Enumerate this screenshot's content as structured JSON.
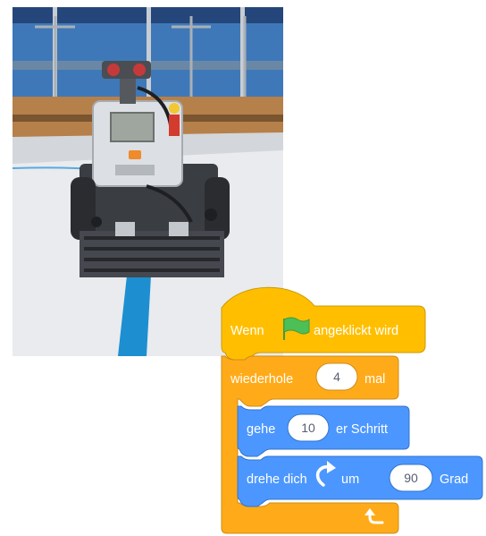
{
  "photo": {
    "icon": "robot-photo",
    "colors": {
      "window": "#2f6fb4",
      "table": "#eef0f2",
      "line": "#1d8fd1",
      "brick": "#3a3d42"
    }
  },
  "script": {
    "hat": {
      "prefix": "Wenn",
      "flag_icon": "green-flag-icon",
      "suffix": "angeklickt wird"
    },
    "repeat": {
      "label": "wiederhole",
      "count": "4",
      "unit": "mal",
      "arrow_icon": "loop-arrow-icon"
    },
    "move": {
      "label": "gehe",
      "steps": "10",
      "unit": "er Schritt"
    },
    "turn": {
      "label": "drehe dich",
      "icon": "turn-right-icon",
      "um": "um",
      "degrees": "90",
      "unit": "Grad"
    },
    "colors": {
      "events": "#ffbf00",
      "events_border": "#cc9900",
      "control": "#ffab19",
      "control_border": "#cf8b17",
      "motion": "#4c97ff",
      "motion_border": "#3373cc",
      "flag": "#4cbf56"
    }
  }
}
